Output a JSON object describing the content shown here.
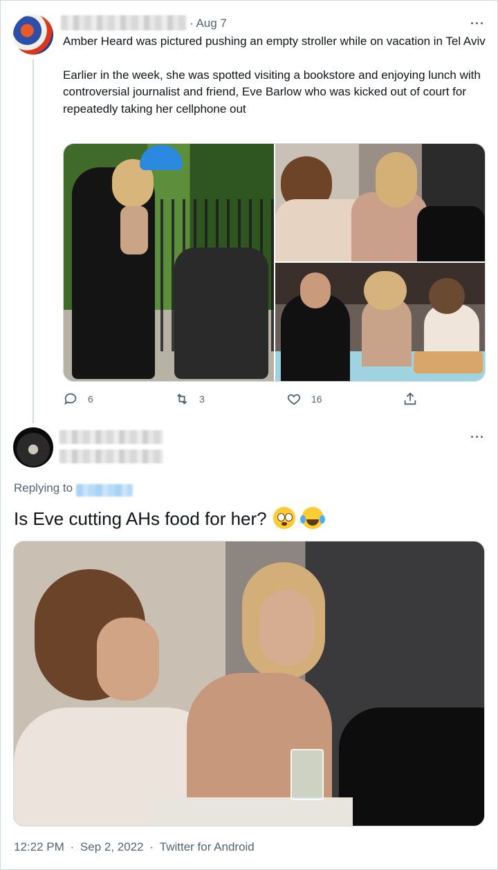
{
  "tweet1": {
    "date": "· Aug 7",
    "more": "···",
    "paragraphs": [
      "Amber Heard was pictured pushing an empty stroller while on vacation in Tel Aviv",
      "Earlier in the week, she was spotted visiting a bookstore and enjoying lunch with controversial journalist and friend, Eve Barlow who was kicked out of court for repeatedly taking her cellphone out"
    ],
    "actions": {
      "replies": "6",
      "retweets": "3",
      "likes": "16"
    }
  },
  "tweet2": {
    "more": "···",
    "replying_to_label": "Replying to",
    "text": "Is Eve cutting AHs food for her?",
    "timestamp": "12:22 PM",
    "date": "Sep 2, 2022",
    "source": "Twitter for Android",
    "separator": "·"
  },
  "icons": {
    "reply": "reply-icon",
    "retweet": "retweet-icon",
    "like": "heart-icon",
    "share": "share-icon",
    "emoji1": "flushed-face-emoji",
    "emoji2": "tears-of-joy-emoji"
  },
  "colors": {
    "secondary_text": "#536471",
    "border": "#cfd9de",
    "primary_text": "#0f1419"
  }
}
